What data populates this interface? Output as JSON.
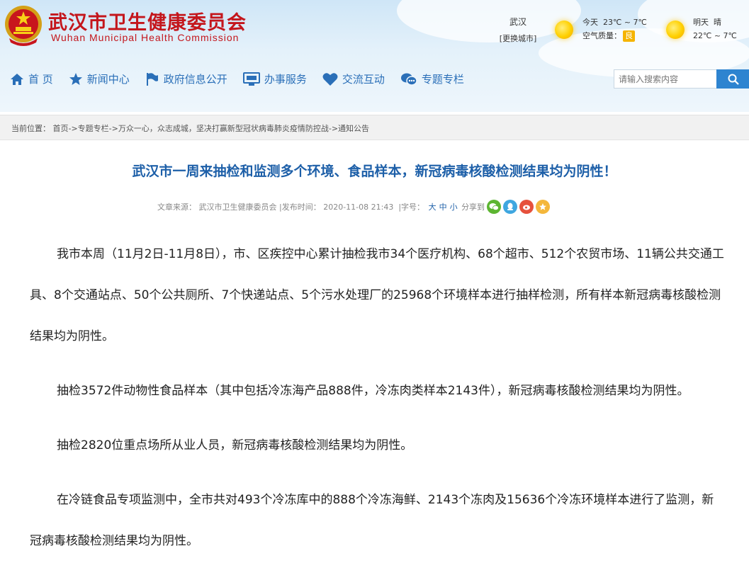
{
  "header": {
    "site_title_cn": "武汉市卫生健康委员会",
    "site_title_en": "Wuhan Municipal Health Commission"
  },
  "weather": {
    "city": "武汉",
    "change_city": "[更换城市]",
    "today_label": "今天",
    "today_temp": "23℃ ~ 7℃",
    "air_quality_label": "空气质量：",
    "air_quality_value": "良",
    "tomorrow_label": "明天",
    "tomorrow_cond": "晴",
    "tomorrow_temp": "22℃ ~ 7℃",
    "sun_color": "#ffd000"
  },
  "nav": {
    "items": [
      {
        "label": "首 页",
        "icon": "home-icon"
      },
      {
        "label": "新闻中心",
        "icon": "star-icon"
      },
      {
        "label": "政府信息公开",
        "icon": "flag-icon"
      },
      {
        "label": "办事服务",
        "icon": "monitor-icon"
      },
      {
        "label": "交流互动",
        "icon": "heart-icon"
      },
      {
        "label": "专题专栏",
        "icon": "chat-icon"
      }
    ],
    "color": "#2a6fb8"
  },
  "search": {
    "placeholder": "请输入搜索内容",
    "button_icon": "search-icon"
  },
  "breadcrumb": {
    "label": "当前位置：",
    "path": "首页->专题专栏->万众一心，众志成城，坚决打赢新型冠状病毒肺炎疫情防控战->通知公告"
  },
  "article": {
    "title": "武汉市一周来抽检和监测多个环境、食品样本，新冠病毒核酸检测结果均为阴性！",
    "source_label": "文章来源：",
    "source": "武汉市卫生健康委员会",
    "date_label": "|发布时间：",
    "date": "2020-11-08 21:43",
    "font_label": "|字号：",
    "font_large": "大",
    "font_medium": "中",
    "font_small": "小",
    "share_label": "分享到",
    "paragraphs": [
      "我市本周（11月2日-11月8日），市、区疾控中心累计抽检我市34个医疗机构、68个超市、512个农贸市场、11辆公共交通工具、8个交通站点、50个公共厕所、7个快递站点、5个污水处理厂的25968个环境样本进行抽样检测，所有样本新冠病毒核酸检测结果均为阴性。",
      "抽检3572件动物性食品样本（其中包括冷冻海产品888件，冷冻肉类样本2143件），新冠病毒核酸检测结果均为阴性。",
      "抽检2820位重点场所从业人员，新冠病毒核酸检测结果均为阴性。",
      "在冷链食品专项监测中，全市共对493个冷冻库中的888个冷冻海鲜、2143个冻肉及15636个冷冻环境样本进行了监测，新冠病毒核酸检测结果均为阴性。"
    ]
  }
}
